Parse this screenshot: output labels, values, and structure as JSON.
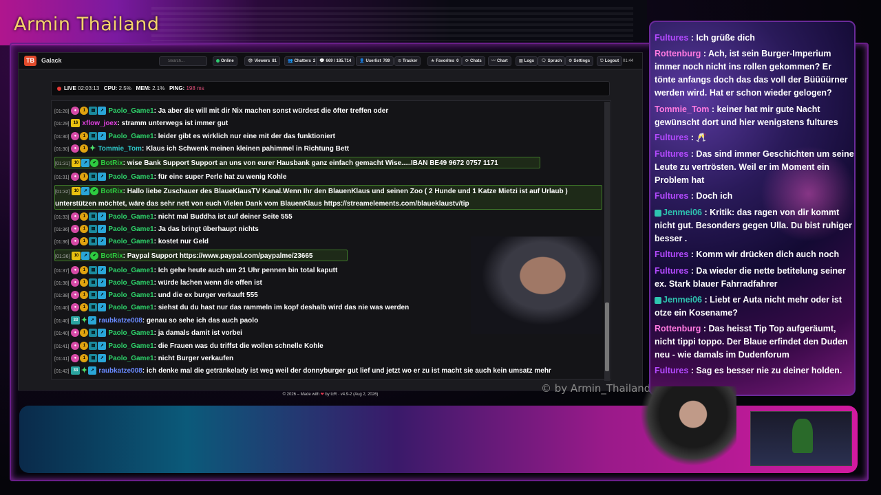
{
  "channel": {
    "title": "Armin Thailand"
  },
  "app": {
    "logo": "TB",
    "name": "Galack",
    "search_placeholder": "Search...",
    "toolbar": [
      {
        "label": "Online",
        "icon": "status-dot"
      },
      {
        "label": "Viewers",
        "value": "81"
      },
      {
        "label": "Chatters",
        "value": "2"
      },
      {
        "label": "669 / 185.714"
      },
      {
        "label": "Userlist",
        "value": "789"
      },
      {
        "label": "Tracker"
      },
      {
        "label": "Favorites",
        "value": "0"
      },
      {
        "label": "Chats"
      },
      {
        "label": "Chart"
      },
      {
        "label": "Logs"
      },
      {
        "label": "Spruch"
      },
      {
        "label": "Settings"
      },
      {
        "label": "Logout"
      }
    ],
    "clock": "01:44"
  },
  "status": {
    "live": "LIVE",
    "uptime": "02:03:13",
    "cpu_label": "CPU:",
    "cpu": "2.5%",
    "mem_label": "MEM:",
    "mem": "2.1%",
    "ping_label": "PING:",
    "ping": "198 ms"
  },
  "messages": [
    {
      "t": "[01:28]",
      "user": "Paolo_Game1",
      "cls": "u-paolo",
      "text": "Ja aber die will mit dir Nix machen sonst würdest die öfter treffen oder"
    },
    {
      "t": "[01:29]",
      "user": "xflow_joex",
      "cls": "u-xflow",
      "text": "stramm unterwegs ist immer gut"
    },
    {
      "t": "[01:30]",
      "user": "Paolo_Game1",
      "cls": "u-paolo",
      "text": "leider gibt es wirklich nur eine mit der das funktioniert"
    },
    {
      "t": "[01:30]",
      "user": "Tommie_Tom",
      "cls": "u-tommie",
      "text": "Klaus ich Schwenk meinen kleinen pahimmel in Richtung Bett"
    },
    {
      "t": "[01:31]",
      "user": "BotRix",
      "cls": "u-botrix",
      "text": "wise Bank Support Support an uns von eurer Hausbank ganz einfach gemacht Wise.....IBAN BE49 9672 0757 1171"
    },
    {
      "t": "[01:31]",
      "user": "Paolo_Game1",
      "cls": "u-paolo",
      "text": "für eine super Perle hat zu wenig Kohle"
    },
    {
      "t": "[01:32]",
      "user": "BotRix",
      "cls": "u-botrix",
      "text": "Hallo liebe Zuschauer des BlaueKlausTV Kanal.Wenn Ihr den BlauenKlaus und seinen Zoo ( 2 Hunde und 1 Katze Mietzi ist auf Urlaub ) unterstützen möchtet, wäre das sehr nett von euch Vielen Dank vom BlauenKlaus https://streamelements.com/blaueklaustv/tip"
    },
    {
      "t": "[01:33]",
      "user": "Paolo_Game1",
      "cls": "u-paolo",
      "text": "nicht mal Buddha ist auf deiner Seite 555"
    },
    {
      "t": "[01:36]",
      "user": "Paolo_Game1",
      "cls": "u-paolo",
      "text": "Ja das bringt überhaupt nichts"
    },
    {
      "t": "[01:36]",
      "user": "Paolo_Game1",
      "cls": "u-paolo",
      "text": "kostet nur Geld"
    },
    {
      "t": "[01:36]",
      "user": "BotRix",
      "cls": "u-botrix",
      "text": "Paypal Support https://www.paypal.com/paypalme/23665"
    },
    {
      "t": "[01:37]",
      "user": "Paolo_Game1",
      "cls": "u-paolo",
      "text": "Ich gehe heute auch um 21 Uhr pennen bin total kaputt"
    },
    {
      "t": "[01:38]",
      "user": "Paolo_Game1",
      "cls": "u-paolo",
      "text": "würde lachen wenn die offen ist"
    },
    {
      "t": "[01:38]",
      "user": "Paolo_Game1",
      "cls": "u-paolo",
      "text": "und die ex burger verkauft 555"
    },
    {
      "t": "[01:40]",
      "user": "Paolo_Game1",
      "cls": "u-paolo",
      "text": "siehst du du hast nur das rammeln im kopf deshalb wird das nie was werden"
    },
    {
      "t": "[01:40]",
      "user": "raubkatze008",
      "cls": "u-raub",
      "text": "genau so sehe ich das auch paolo"
    },
    {
      "t": "[01:40]",
      "user": "Paolo_Game1",
      "cls": "u-paolo",
      "text": "ja damals damit ist vorbei"
    },
    {
      "t": "[01:41]",
      "user": "Paolo_Game1",
      "cls": "u-paolo",
      "text": "die Frauen was du triffst die wollen schnelle Kohle"
    },
    {
      "t": "[01:41]",
      "user": "Paolo_Game1",
      "cls": "u-paolo",
      "text": "nicht Burger verkaufen"
    },
    {
      "t": "[01:42]",
      "user": "raubkatze008",
      "cls": "u-raub",
      "text": "ich denke mal die getränkelady ist weg weil der donnyburger gut lief und jetzt wo er zu ist macht sie auch kein umsatz mehr"
    }
  ],
  "watermark": "© by Armin_Thailand",
  "footer": {
    "before": "© 2026 – Made with",
    "after": "by tcR · v4.9-2 (Aug 2, 2026)"
  },
  "side_chat": [
    {
      "user": "Fultures",
      "cls": "sc-fultures",
      "text": "Ich grüße dich"
    },
    {
      "user": "Rottenburg",
      "cls": "sc-rotten",
      "text": "Ach, ist sein Burger-Imperium immer noch nicht ins rollen gekommen? Er tönte anfangs doch das das voll der Büüüürner werden wird. Hat er schon wieder gelogen?"
    },
    {
      "user": "Tommie_Tom",
      "cls": "sc-tommie",
      "text": "keiner hat mir gute Nacht gewünscht dort und hier wenigstens fultures"
    },
    {
      "user": "Fultures",
      "cls": "sc-fultures",
      "text": "🥂"
    },
    {
      "user": "Fultures",
      "cls": "sc-fultures",
      "text": "Das sind immer Geschichten um seine Leute zu vertrösten. Weil er im Moment ein Problem hat"
    },
    {
      "user": "Fultures",
      "cls": "sc-fultures",
      "text": "Doch ich"
    },
    {
      "user": "Jenmei06",
      "cls": "sc-jenmei",
      "text": "Kritik: das ragen von dir kommt nicht gut. Besonders gegen Ulla. Du bist ruhiger besser ."
    },
    {
      "user": "Fultures",
      "cls": "sc-fultures",
      "text": "Komm wir drücken dich auch noch"
    },
    {
      "user": "Fultures",
      "cls": "sc-fultures",
      "text": "Da wieder die nette betitelung seiner ex. Stark blauer Fahrradfahrer"
    },
    {
      "user": "Jenmei06",
      "cls": "sc-jenmei",
      "text": "Liebt er Auta nicht mehr oder ist otze ein Kosename?"
    },
    {
      "user": "Rottenburg",
      "cls": "sc-rotten",
      "text": "Das heisst Tip Top aufgeräumt, nicht tippi toppo. Der Blaue erfindet den Duden neu - wie damals im Dudenforum"
    },
    {
      "user": "Fultures",
      "cls": "sc-fultures",
      "text": "Sag es besser nie zu deiner holden."
    }
  ]
}
